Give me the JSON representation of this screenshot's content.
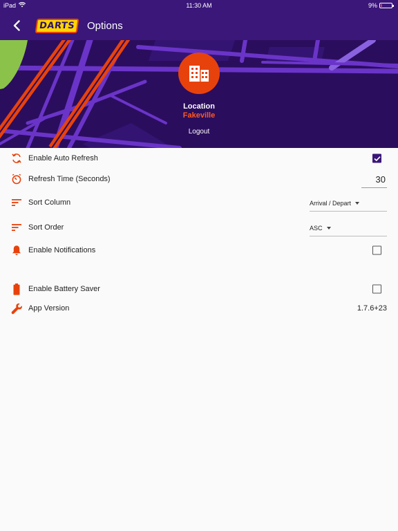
{
  "status_bar": {
    "device": "iPad",
    "time": "11:30 AM",
    "battery": "9%"
  },
  "header": {
    "logo_text": "DARTS",
    "title": "Options"
  },
  "hero": {
    "location_title": "Location",
    "location_value": "Fakeville",
    "logout_label": "Logout"
  },
  "settings": {
    "auto_refresh": {
      "label": "Enable Auto Refresh",
      "checked": true
    },
    "refresh_time": {
      "label": "Refresh Time (Seconds)",
      "value": "30"
    },
    "sort_column": {
      "label": "Sort Column",
      "value": "Arrival / Depart"
    },
    "sort_order": {
      "label": "Sort Order",
      "value": "ASC"
    },
    "notifications": {
      "label": "Enable Notifications",
      "checked": false
    },
    "battery_saver": {
      "label": "Enable Battery Saver",
      "checked": false
    },
    "app_version": {
      "label": "App Version",
      "value": "1.7.6+23"
    }
  },
  "colors": {
    "primary": "#3a1779",
    "accent": "#e8420c",
    "hero_bg": "#2b0d5e",
    "background": "#fafafa"
  },
  "icons": {
    "refresh": "refresh-icon",
    "timer": "timer-icon",
    "sort_column": "sort-icon",
    "sort_order": "sort-icon",
    "notifications": "bell-icon",
    "battery": "battery-icon",
    "version": "wrench-icon",
    "location": "building-icon",
    "back": "back-arrow-icon"
  }
}
